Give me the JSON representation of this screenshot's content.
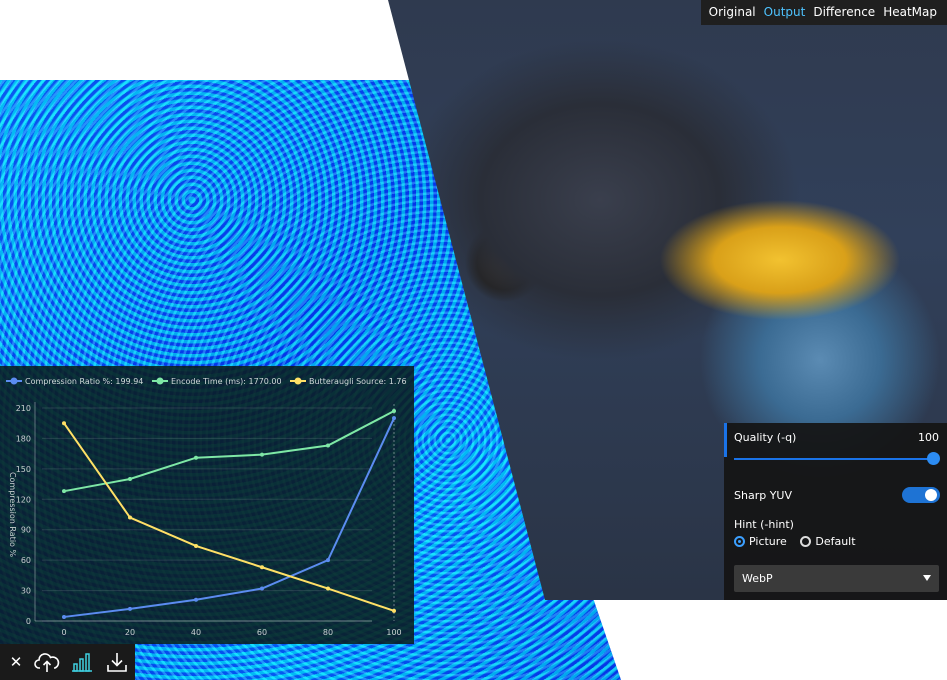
{
  "view_modes": [
    "Original",
    "Output",
    "Difference",
    "HeatMap"
  ],
  "active_view": "Output",
  "settings": {
    "quality_label": "Quality (-q)",
    "quality_value": "100",
    "quality_level": 1.0,
    "sharp_yuv_label": "Sharp YUV",
    "sharp_yuv_on": true,
    "hint_label": "Hint (-hint)",
    "hint_options": [
      "Picture",
      "Default"
    ],
    "hint_selected": "Picture",
    "format_value": "WebP"
  },
  "chart_data": {
    "type": "line",
    "x": [
      0,
      20,
      40,
      60,
      80,
      100
    ],
    "series": [
      {
        "name": "Compression Ratio %: 199.94",
        "color": "#5b8cf0",
        "values": [
          4,
          12,
          21,
          32,
          60,
          200
        ]
      },
      {
        "name": "Encode Time (ms): 1770.00",
        "color": "#7ee8a6",
        "values": [
          128,
          140,
          161,
          164,
          173,
          207
        ]
      },
      {
        "name": "Butteraugli Source: 1.76",
        "color": "#ffe066",
        "values": [
          195,
          102,
          74,
          53,
          32,
          10
        ]
      }
    ],
    "ylabel": "Compression Ratio %",
    "yticks": [
      0,
      30,
      60,
      90,
      120,
      150,
      180,
      210
    ],
    "xticks": [
      0,
      20,
      40,
      60,
      80,
      100
    ],
    "ylim": [
      0,
      210
    ],
    "xlim": [
      0,
      100
    ],
    "grid": true,
    "legend": "top",
    "hover_x": 100
  },
  "toolbar": {
    "icons": [
      "close-icon",
      "upload-cloud-icon",
      "bar-chart-icon",
      "download-icon"
    ],
    "close_glyph": "✕"
  }
}
